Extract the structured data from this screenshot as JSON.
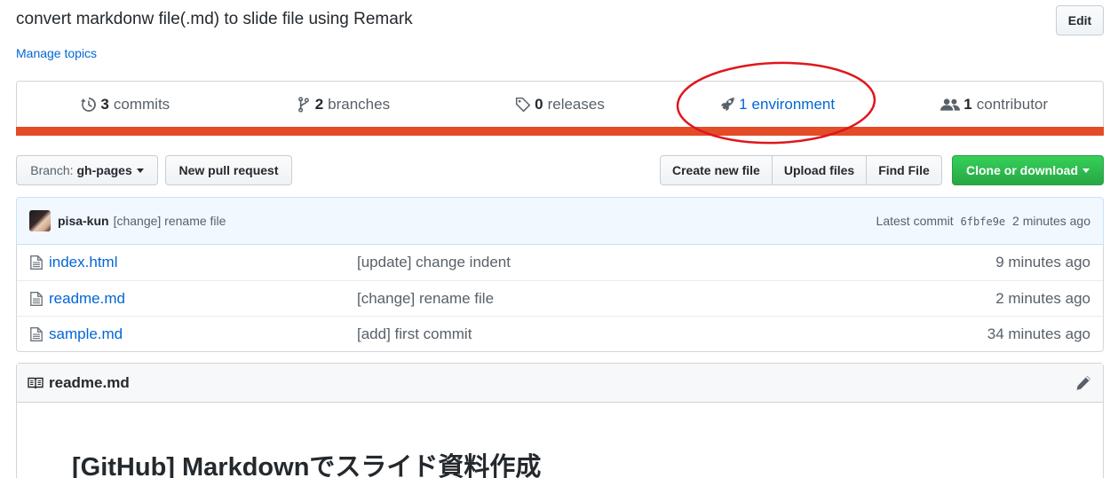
{
  "repo": {
    "description": "convert markdonw file(.md) to slide file using Remark",
    "manage_topics": "Manage topics",
    "edit_label": "Edit"
  },
  "summary": {
    "commits": {
      "count": "3",
      "label": "commits",
      "icon": "history-icon"
    },
    "branches": {
      "count": "2",
      "label": "branches",
      "icon": "git-branch-icon"
    },
    "releases": {
      "count": "0",
      "label": "releases",
      "icon": "tag-icon"
    },
    "environments": {
      "count": "1",
      "label": "environment",
      "icon": "rocket-icon"
    },
    "contributors": {
      "count": "1",
      "label": "contributor",
      "icon": "people-icon"
    },
    "language_color": "#e34c26",
    "annotation_color": "#e0161b"
  },
  "toolbar": {
    "branch_prefix": "Branch:",
    "branch_name": "gh-pages",
    "new_pull_request": "New pull request",
    "create_new_file": "Create new file",
    "upload_files": "Upload files",
    "find_file": "Find File",
    "clone_or_download": "Clone or download",
    "clone_color": "#28a745"
  },
  "latest_commit": {
    "author": "pisa-kun",
    "message": "[change] rename file",
    "prefix": "Latest commit",
    "sha": "6fbfe9e",
    "age": "2 minutes ago"
  },
  "files": [
    {
      "name": "index.html",
      "message": "[update] change indent",
      "age": "9 minutes ago"
    },
    {
      "name": "readme.md",
      "message": "[change] rename file",
      "age": "2 minutes ago"
    },
    {
      "name": "sample.md",
      "message": "[add] first commit",
      "age": "34 minutes ago"
    }
  ],
  "readme": {
    "filename": "readme.md",
    "heading": "[GitHub] Markdownでスライド資料作成"
  }
}
